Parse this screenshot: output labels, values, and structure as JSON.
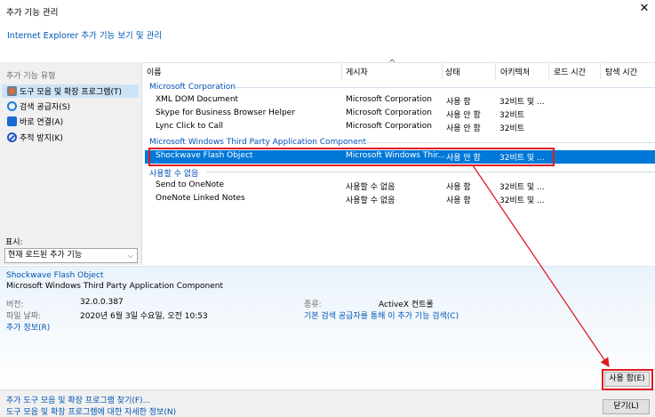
{
  "window": {
    "title": "추가 기능 관리",
    "subtitle": "Internet Explorer 추가 기능 보기 및 관리",
    "close_glyph": "✕"
  },
  "sidebar": {
    "types_label": "추가 기능 유형",
    "items": [
      {
        "label": "도구 모음 및 확장 프로그램(T)",
        "icon": "toolbar-extension-icon",
        "selected": true
      },
      {
        "label": "검색 공급자(S)",
        "icon": "search-icon",
        "selected": false
      },
      {
        "label": "바로 연결(A)",
        "icon": "accelerator-icon",
        "selected": false
      },
      {
        "label": "추적 방지(K)",
        "icon": "tracking-protection-icon",
        "selected": false
      }
    ],
    "show_label": "표시:",
    "show_value": "현재 로드된 추가 기능",
    "show_arrow": "⌵"
  },
  "list": {
    "columns": [
      "이름",
      "게시자",
      "상태",
      "아키텍처",
      "로드 시간",
      "탐색 시간"
    ],
    "sort_glyph": "^",
    "groups": [
      {
        "name": "Microsoft Corporation",
        "rows": [
          {
            "name": "XML DOM Document",
            "publisher": "Microsoft Corporation",
            "status": "사용 함",
            "arch": "32비트 및 ...",
            "selected": false
          },
          {
            "name": "Skype for Business Browser Helper",
            "publisher": "Microsoft Corporation",
            "status": "사용 안 함",
            "arch": "32비트",
            "selected": false
          },
          {
            "name": "Lync Click to Call",
            "publisher": "Microsoft Corporation",
            "status": "사용 안 함",
            "arch": "32비트",
            "selected": false
          }
        ]
      },
      {
        "name": "Microsoft Windows Third Party Application Component",
        "rows": [
          {
            "name": "Shockwave Flash Object",
            "publisher": "Microsoft Windows Thir...",
            "status": "사용 안 함",
            "arch": "32비트 및 ...",
            "selected": true
          }
        ]
      },
      {
        "name": "사용할 수 없음",
        "rows": [
          {
            "name": "Send to OneNote",
            "publisher": "사용할 수 없음",
            "status": "사용 함",
            "arch": "32비트 및 ...",
            "selected": false
          },
          {
            "name": "OneNote Linked Notes",
            "publisher": "사용할 수 없음",
            "status": "사용 함",
            "arch": "32비트 및 ...",
            "selected": false
          }
        ]
      }
    ]
  },
  "details": {
    "name": "Shockwave Flash Object",
    "publisher": "Microsoft Windows Third Party Application Component",
    "version_label": "버전:",
    "version_value": "32.0.0.387",
    "date_label": "파일 날짜:",
    "date_value": "2020년 6월 3일 수요일, 오전 10:53",
    "more_info": "추가 정보(R)",
    "type_label": "종류:",
    "type_value": "ActiveX 컨트롤",
    "search_link": "기본 검색 공급자를 통해 이 추가 기능 검색(C)",
    "enable_button": "사용 함(E)"
  },
  "footer": {
    "find_link": "추가 도구 모음 및 확장 프로그램 찾기(F)...",
    "learn_link": "도구 모음 및 확장 프로그램에 대한 자세한 정보(N)",
    "close_button": "닫기(L)"
  },
  "colors": {
    "selection": "#0078d7",
    "link": "#0055b4",
    "annotation": "#e01a22"
  }
}
